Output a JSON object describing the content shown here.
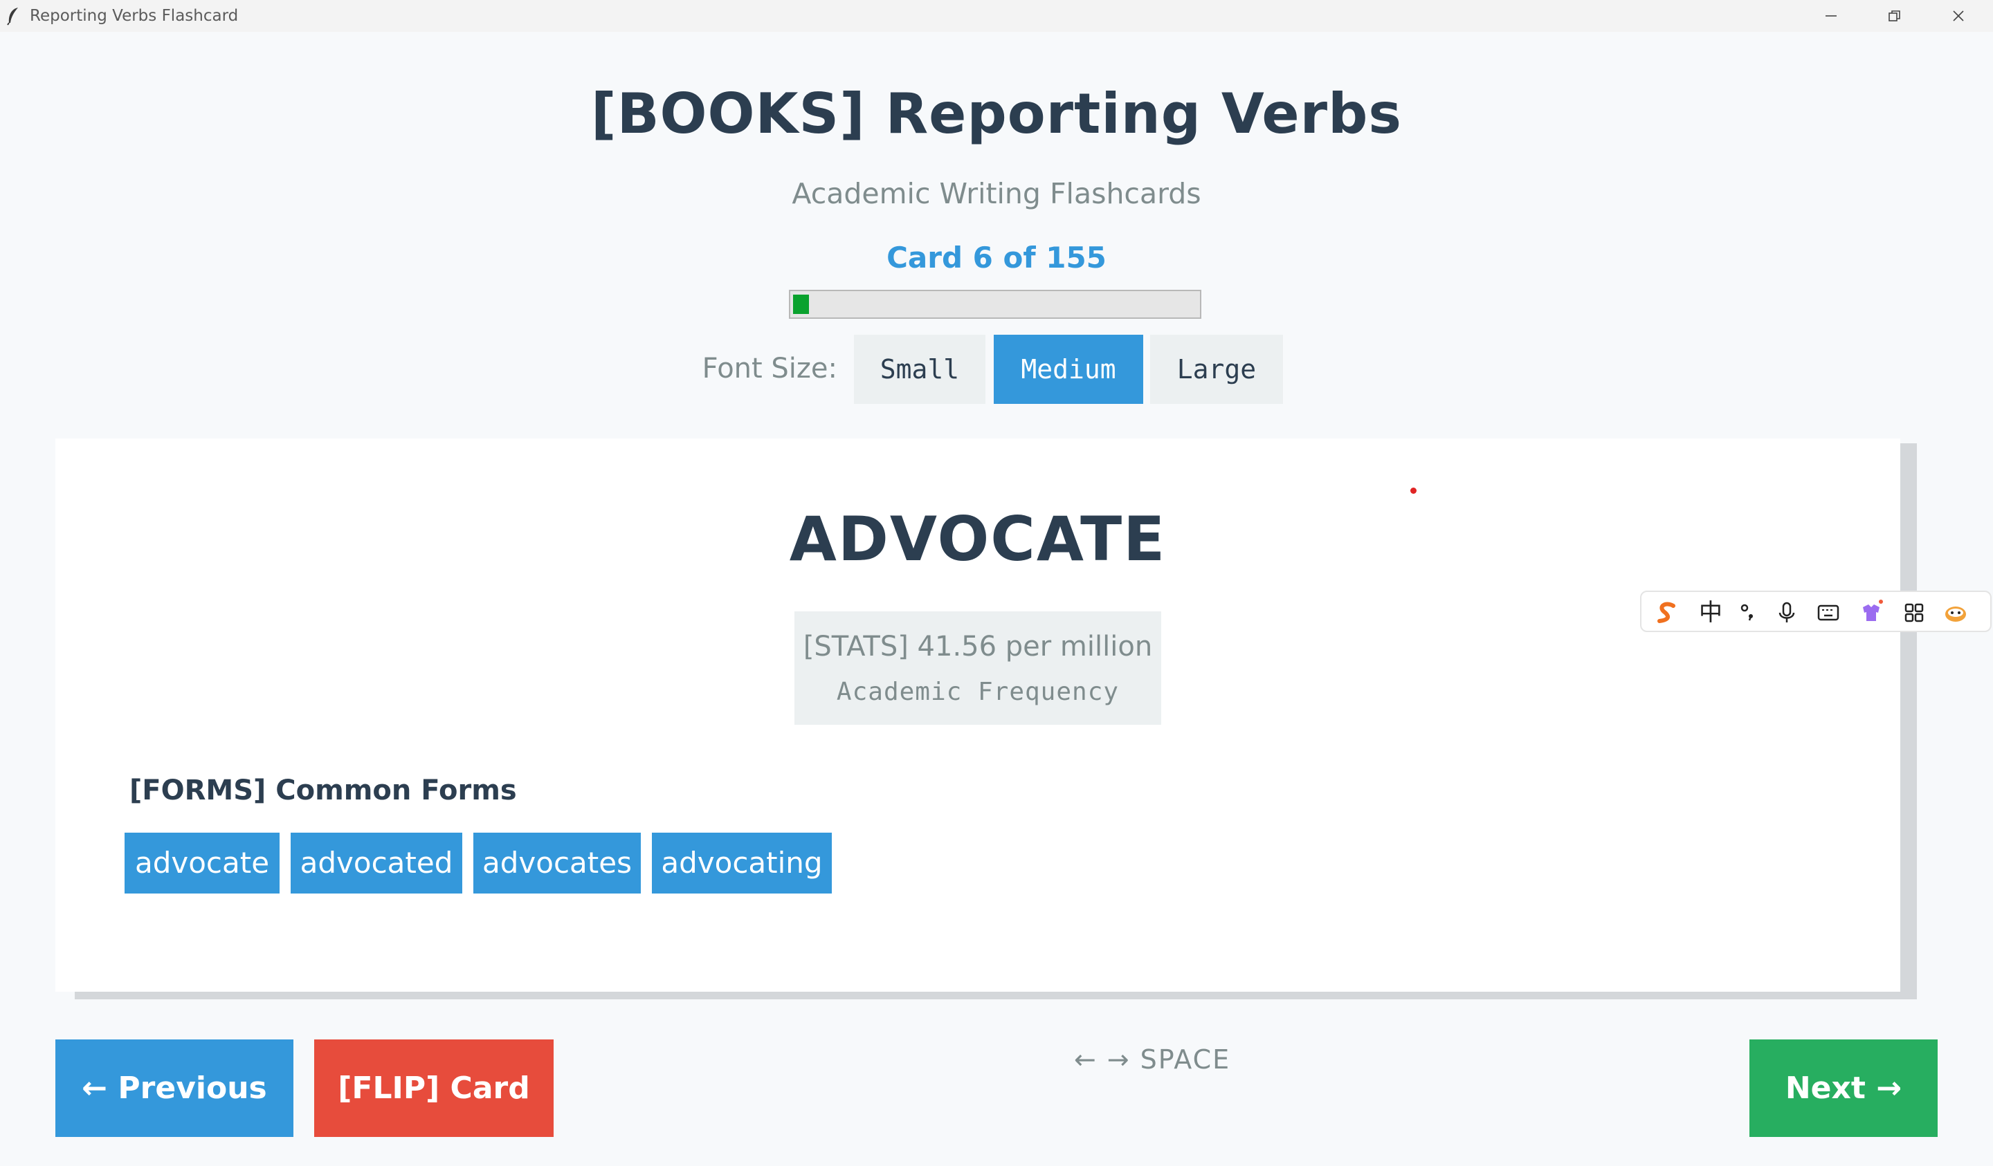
{
  "window": {
    "title": "Reporting Verbs Flashcard",
    "icon": "feather-icon"
  },
  "header": {
    "title": "[BOOKS] Reporting Verbs",
    "subtitle": "Academic Writing Flashcards",
    "counter": "Card 6 of 155",
    "progress": 0.039
  },
  "font_size": {
    "label": "Font Size:",
    "options": [
      "Small",
      "Medium",
      "Large"
    ],
    "selected": "Medium"
  },
  "card": {
    "word": "ADVOCATE",
    "stats_value": "[STATS] 41.56 per million",
    "stats_label": "Academic Frequency",
    "forms_heading": "[FORMS] Common Forms",
    "forms": [
      "advocate",
      "advocated",
      "advocates",
      "advocating"
    ]
  },
  "ime_toolbar": {
    "chinese_char": "中",
    "icons": [
      "sogou-logo-icon",
      "punctuation-icon",
      "microphone-icon",
      "keyboard-icon",
      "skin-icon",
      "toolbox-icon",
      "mascot-icon"
    ]
  },
  "navigation": {
    "previous_label": "← Previous",
    "flip_label": "[FLIP] Card",
    "next_label": "Next →",
    "shortcut_hint": "← → SPACE"
  },
  "colors": {
    "accent_blue": "#3498db",
    "flip_red": "#e74c3c",
    "next_green": "#27ae60",
    "progress_green": "#0aa22e",
    "heading_text": "#2c3e50",
    "muted_text": "#7f8c8d"
  }
}
